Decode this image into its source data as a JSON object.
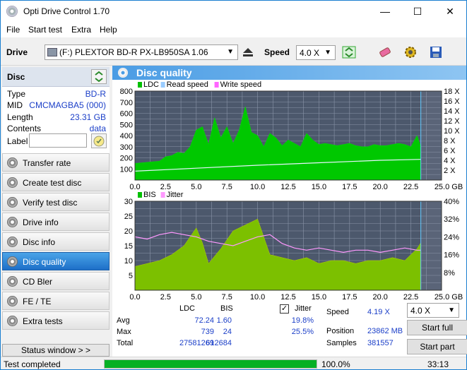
{
  "window": {
    "title": "Opti Drive Control 1.70",
    "minimize": "—",
    "maximize": "☐",
    "close": "✕"
  },
  "menu": [
    "File",
    "Start test",
    "Extra",
    "Help"
  ],
  "toolbar": {
    "drive_label": "Drive",
    "drive_value": "(F:)   PLEXTOR BD-R   PX-LB950SA 1.06",
    "speed_label": "Speed",
    "speed_value": "4.0 X"
  },
  "disc": {
    "header": "Disc",
    "rows": [
      {
        "k": "Type",
        "v": "BD-R"
      },
      {
        "k": "MID",
        "v": "CMCMAGBA5 (000)"
      },
      {
        "k": "Length",
        "v": "23.31 GB"
      },
      {
        "k": "Contents",
        "v": "data"
      }
    ],
    "label_key": "Label",
    "label_value": ""
  },
  "nav": [
    {
      "label": "Transfer rate",
      "active": false
    },
    {
      "label": "Create test disc",
      "active": false
    },
    {
      "label": "Verify test disc",
      "active": false
    },
    {
      "label": "Drive info",
      "active": false
    },
    {
      "label": "Disc info",
      "active": false
    },
    {
      "label": "Disc quality",
      "active": true
    },
    {
      "label": "CD Bler",
      "active": false
    },
    {
      "label": "FE / TE",
      "active": false
    },
    {
      "label": "Extra tests",
      "active": false
    }
  ],
  "status_window_button": "Status window > >",
  "panel_title": "Disc quality",
  "chart_data": [
    {
      "type": "area",
      "legend": [
        "LDC",
        "Read speed",
        "Write speed"
      ],
      "legend_colors": [
        "#00c000",
        "#99ccff",
        "#ff66ff"
      ],
      "x_ticks": [
        "0.0",
        "2.5",
        "5.0",
        "7.5",
        "10.0",
        "12.5",
        "15.0",
        "17.5",
        "20.0",
        "22.5",
        "25.0 GB"
      ],
      "y_left_ticks": [
        "800",
        "700",
        "600",
        "500",
        "400",
        "300",
        "200",
        "100"
      ],
      "y_right_ticks": [
        "18 X",
        "16 X",
        "14 X",
        "12 X",
        "10 X",
        "8 X",
        "6 X",
        "4 X",
        "2 X"
      ],
      "xlim": [
        0,
        25
      ],
      "ylim": [
        0,
        800
      ],
      "y2lim": [
        0,
        18
      ],
      "ldc_x": [
        0,
        1,
        2,
        2.5,
        3,
        3.5,
        4,
        4.5,
        5,
        5.5,
        6,
        6.5,
        7,
        7.5,
        8,
        8.5,
        9,
        9.5,
        10,
        10.5,
        11,
        11.5,
        12,
        12.5,
        13,
        13.5,
        14,
        14.5,
        15,
        15.5,
        16,
        16.5,
        17,
        17.5,
        18,
        18.5,
        19,
        19.5,
        20,
        20.5,
        21,
        21.5,
        22,
        22.5,
        23,
        23.31
      ],
      "ldc_y": [
        150,
        160,
        170,
        210,
        220,
        250,
        240,
        300,
        450,
        480,
        320,
        560,
        380,
        480,
        330,
        450,
        660,
        430,
        400,
        300,
        420,
        380,
        310,
        360,
        330,
        300,
        420,
        360,
        320,
        330,
        320,
        310,
        320,
        330,
        310,
        300,
        300,
        320,
        310,
        310,
        320,
        330,
        320,
        300,
        400,
        300
      ],
      "read_speed_x": [
        0,
        5,
        10,
        15,
        20,
        23.31
      ],
      "read_speed_y": [
        1.8,
        2.4,
        3.0,
        3.5,
        4.0,
        4.19
      ]
    },
    {
      "type": "area",
      "legend": [
        "BIS",
        "Jitter"
      ],
      "legend_colors": [
        "#00c000",
        "#ff99ff"
      ],
      "x_ticks": [
        "0.0",
        "2.5",
        "5.0",
        "7.5",
        "10.0",
        "12.5",
        "15.0",
        "17.5",
        "20.0",
        "22.5",
        "25.0 GB"
      ],
      "y_left_ticks": [
        "30",
        "25",
        "20",
        "15",
        "10",
        "5"
      ],
      "y_right_ticks": [
        "40%",
        "32%",
        "24%",
        "16%",
        "8%"
      ],
      "xlim": [
        0,
        25
      ],
      "ylim": [
        0,
        30
      ],
      "y2lim": [
        0,
        40
      ],
      "bis_x": [
        0,
        1,
        2,
        3,
        4,
        5,
        5.5,
        6,
        7,
        8,
        9,
        10,
        11,
        12,
        13,
        14,
        15,
        16,
        17,
        18,
        19,
        20,
        21,
        22,
        23,
        23.31
      ],
      "bis_y": [
        8,
        9,
        10,
        12,
        15,
        21,
        16,
        9,
        14,
        20,
        22,
        24,
        12,
        11,
        10,
        11,
        9,
        10,
        10,
        9,
        10,
        10,
        11,
        10,
        14,
        16
      ],
      "jitter_x": [
        0,
        1,
        2,
        3,
        4,
        5,
        6,
        7,
        8,
        9,
        10,
        11,
        12,
        13,
        14,
        15,
        16,
        17,
        18,
        19,
        20,
        21,
        22,
        23,
        23.31
      ],
      "jitter_y": [
        24,
        23,
        25,
        26,
        25,
        24,
        22,
        21,
        20,
        22,
        24,
        25,
        21,
        19,
        18,
        19,
        18,
        17,
        18,
        18,
        17,
        18,
        19,
        18,
        18
      ]
    }
  ],
  "stats": {
    "col_ldc": "LDC",
    "col_bis": "BIS",
    "jitter_label": "Jitter",
    "jitter_checked": "✓",
    "rows": [
      {
        "k": "Avg",
        "ldc": "72.24",
        "bis": "1.60",
        "jit": "19.8%"
      },
      {
        "k": "Max",
        "ldc": "739",
        "bis": "24",
        "jit": "25.5%"
      },
      {
        "k": "Total",
        "ldc": "27581269",
        "bis": "612684",
        "jit": ""
      }
    ],
    "speed_label": "Speed",
    "speed_value": "4.19 X",
    "position_label": "Position",
    "position_value": "23862 MB",
    "samples_label": "Samples",
    "samples_value": "381557",
    "speed_select": "4.0 X",
    "start_full": "Start full",
    "start_part": "Start part"
  },
  "status": {
    "text": "Test completed",
    "progress": 100.0,
    "progress_text": "100.0%",
    "time": "33:13"
  }
}
